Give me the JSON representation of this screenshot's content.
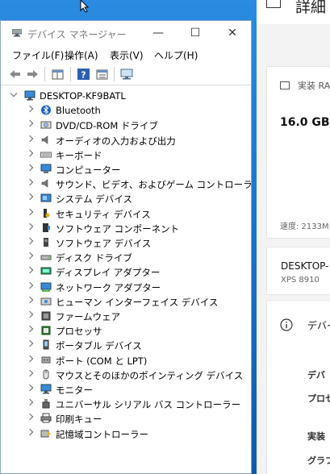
{
  "device_manager": {
    "title": "デバイス マネージャー",
    "buttons": {
      "minimize": "—",
      "maximize": "☐",
      "close": "✕"
    },
    "menu": [
      "ファイル(F)",
      "操作(A)",
      "表示(V)",
      "ヘルプ(H)"
    ],
    "root": "DESKTOP-KF9BATL",
    "categories": [
      {
        "label": "Bluetooth",
        "icon": "bluetooth-icon"
      },
      {
        "label": "DVD/CD-ROM ドライブ",
        "icon": "dvd-drive-icon"
      },
      {
        "label": "オーディオの入力および出力",
        "icon": "speaker-icon"
      },
      {
        "label": "キーボード",
        "icon": "keyboard-icon"
      },
      {
        "label": "コンピューター",
        "icon": "computer-icon"
      },
      {
        "label": "サウンド、ビデオ、およびゲーム コントローラー",
        "icon": "speaker-icon"
      },
      {
        "label": "システム デバイス",
        "icon": "system-device-icon"
      },
      {
        "label": "セキュリティ デバイス",
        "icon": "security-key-icon"
      },
      {
        "label": "ソフトウェア コンポーネント",
        "icon": "software-component-icon"
      },
      {
        "label": "ソフトウェア デバイス",
        "icon": "software-device-icon"
      },
      {
        "label": "ディスク ドライブ",
        "icon": "disk-drive-icon"
      },
      {
        "label": "ディスプレイ アダプター",
        "icon": "display-adapter-icon"
      },
      {
        "label": "ネットワーク アダプター",
        "icon": "network-adapter-icon"
      },
      {
        "label": "ヒューマン インターフェイス デバイス",
        "icon": "hid-icon"
      },
      {
        "label": "ファームウェア",
        "icon": "firmware-icon"
      },
      {
        "label": "プロセッサ",
        "icon": "processor-icon"
      },
      {
        "label": "ポータブル デバイス",
        "icon": "portable-device-icon"
      },
      {
        "label": "ポート (COM と LPT)",
        "icon": "port-icon"
      },
      {
        "label": "マウスとそのほかのポインティング デバイス",
        "icon": "mouse-icon"
      },
      {
        "label": "モニター",
        "icon": "monitor-icon"
      },
      {
        "label": "ユニバーサル シリアル バス コントローラー",
        "icon": "usb-icon"
      },
      {
        "label": "印刷キュー",
        "icon": "printer-icon"
      },
      {
        "label": "記憶域コントローラー",
        "icon": "storage-controller-icon"
      }
    ]
  },
  "settings": {
    "title": "詳細",
    "ram_label": "実装 RA",
    "ram_value": "16.0 GB",
    "speed_label": "速度: 2133M",
    "device_name": "DESKTOP-",
    "model": "XPS 8910",
    "section_title": "デバイ",
    "row1": "デバ",
    "row2": "プロセ",
    "row3": "実装",
    "row4": "グラフ"
  },
  "colors": {
    "desktop": "#1a78d4",
    "window_border": "#8aa7c8",
    "accent": "#0078d7"
  }
}
